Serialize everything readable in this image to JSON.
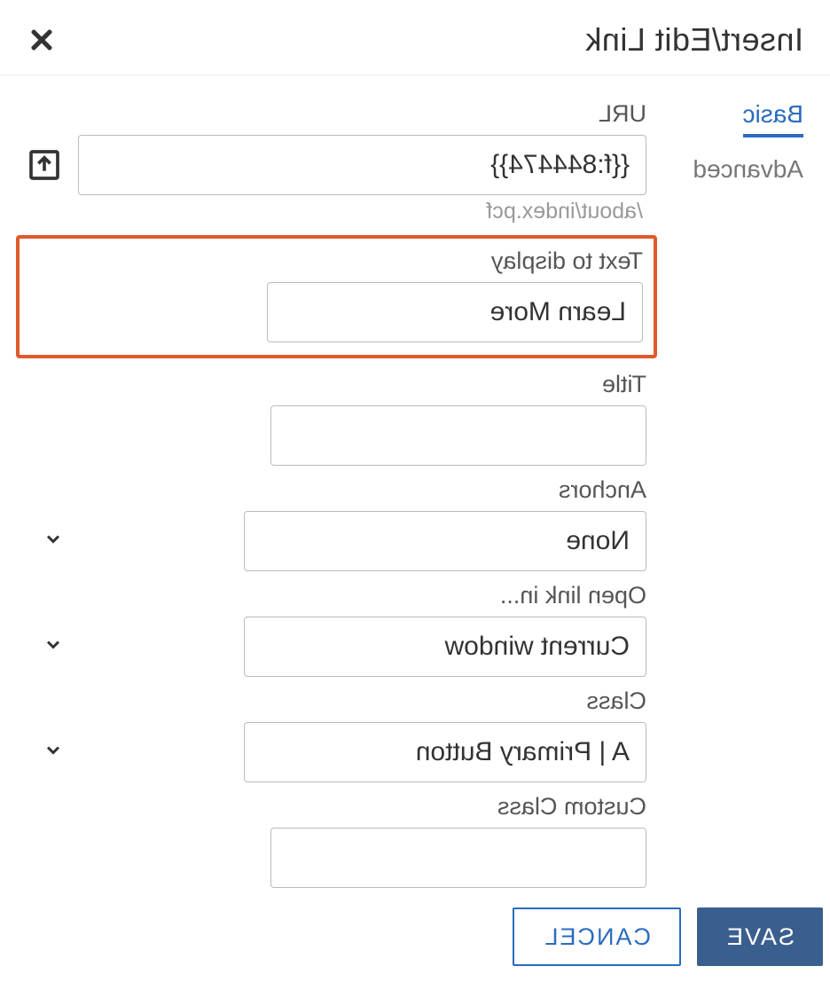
{
  "dialog": {
    "title": "Insert/Edit Link"
  },
  "tabs": {
    "basic": "Basic",
    "advanced": "Advanced"
  },
  "form": {
    "url": {
      "label": "URL",
      "value": "{{f:844474}}",
      "helper": "/about/index.pcf"
    },
    "text_to_display": {
      "label": "Text to display",
      "value": "Learn More"
    },
    "title": {
      "label": "Title",
      "value": ""
    },
    "anchors": {
      "label": "Anchors",
      "value": "None"
    },
    "open_link": {
      "label": "Open link in...",
      "value": "Current window"
    },
    "class": {
      "label": "Class",
      "value": "A | Primary Button"
    },
    "custom_class": {
      "label": "Custom Class",
      "value": ""
    }
  },
  "buttons": {
    "save": "SAVE",
    "cancel": "CANCEL"
  }
}
